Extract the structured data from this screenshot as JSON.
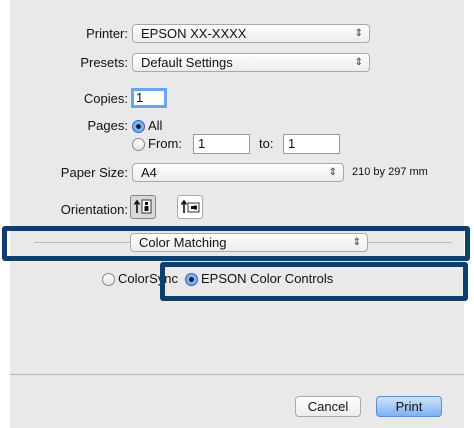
{
  "printer": {
    "label": "Printer:",
    "value": "EPSON XX-XXXX"
  },
  "presets": {
    "label": "Presets:",
    "value": "Default Settings"
  },
  "copies": {
    "label": "Copies:",
    "value": "1"
  },
  "pages": {
    "label": "Pages:",
    "all_label": "All",
    "from_label": "From:",
    "from_value": "1",
    "to_label": "to:",
    "to_value": "1",
    "selected": "All"
  },
  "paper_size": {
    "label": "Paper Size:",
    "value": "A4",
    "dimensions": "210 by 297 mm"
  },
  "orientation": {
    "label": "Orientation:",
    "selected": "portrait",
    "icons": [
      "portrait-orientation-icon",
      "landscape-orientation-icon"
    ]
  },
  "section": {
    "value": "Color Matching"
  },
  "color": {
    "colorsync_label": "ColorSync",
    "epson_label": "EPSON Color Controls",
    "selected": "EPSON Color Controls"
  },
  "buttons": {
    "cancel": "Cancel",
    "print": "Print"
  },
  "icons": {
    "popup_arrows": "⇕",
    "highlight_color": "#0d3f6d"
  }
}
